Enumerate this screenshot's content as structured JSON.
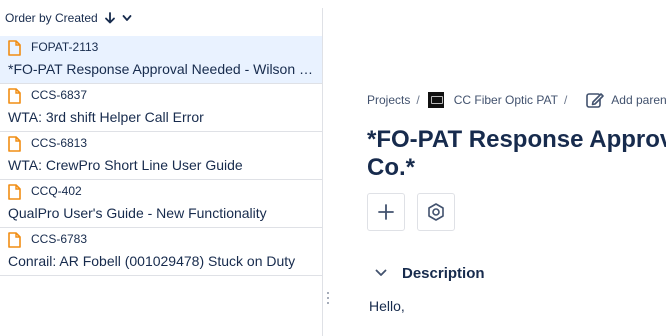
{
  "list_header": {
    "order_label": "Order by Created"
  },
  "issues": [
    {
      "key": "FOPAT-2113",
      "summary": "*FO-PAT Response Approval Needed - Wilson C...",
      "selected": true
    },
    {
      "key": "CCS-6837",
      "summary": "WTA: 3rd shift Helper Call Error",
      "selected": false
    },
    {
      "key": "CCS-6813",
      "summary": "WTA: CrewPro Short Line User Guide",
      "selected": false
    },
    {
      "key": "CCQ-402",
      "summary": "QualPro User's Guide - New Functionality",
      "selected": false
    },
    {
      "key": "CCS-6783",
      "summary": "Conrail: AR Fobell (001029478) Stuck on Duty",
      "selected": false
    }
  ],
  "breadcrumb": {
    "projects": "Projects",
    "separator": "/",
    "project": "CC Fiber Optic PAT",
    "add_parent": "Add parent"
  },
  "issue": {
    "title_line1": "*FO-PAT Response Approva",
    "title_line2": "Co.*"
  },
  "description": {
    "heading": "Description",
    "first_line": "Hello,"
  },
  "colors": {
    "doc_icon": "#f18d13",
    "selected_row_bg": "#e9f2ff",
    "text": "#172b4d",
    "divider": "#dfe1e6"
  }
}
